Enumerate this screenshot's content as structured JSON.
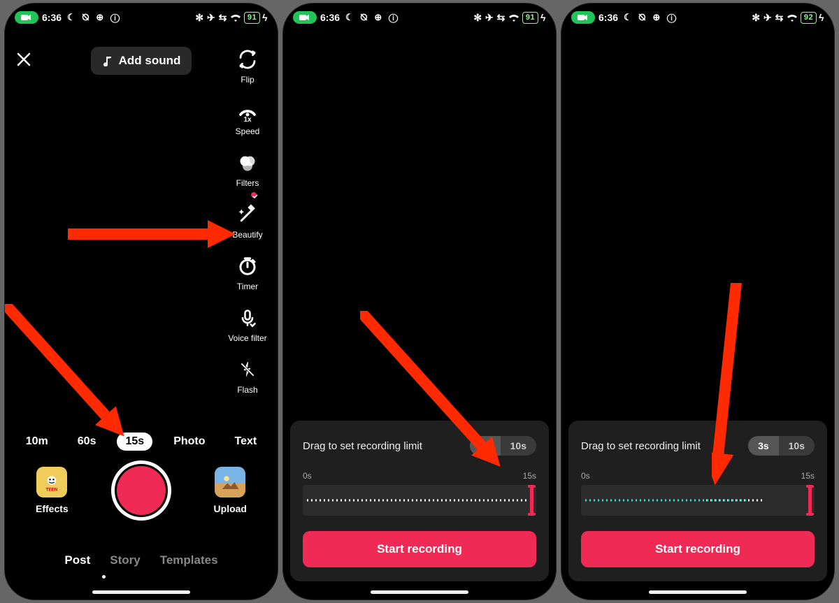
{
  "status": {
    "time": "6:36",
    "left_icons": "☾ ⦰ ⊕ ⓘ",
    "right_icons": "✻ ✈ ⇆",
    "battery1": "91",
    "battery2": "91",
    "battery3": "92"
  },
  "screen1": {
    "add_sound": "Add sound",
    "tools": [
      {
        "id": "flip",
        "label": "Flip"
      },
      {
        "id": "speed",
        "label": "Speed"
      },
      {
        "id": "filters",
        "label": "Filters"
      },
      {
        "id": "beautify",
        "label": "Beautify"
      },
      {
        "id": "timer",
        "label": "Timer"
      },
      {
        "id": "voicefilter",
        "label": "Voice filter"
      },
      {
        "id": "flash",
        "label": "Flash"
      }
    ],
    "durations": [
      "10m",
      "60s",
      "15s",
      "Photo",
      "Text"
    ],
    "duration_active": "15s",
    "effects": "Effects",
    "upload": "Upload",
    "modes": [
      "Post",
      "Story",
      "Templates"
    ],
    "mode_active": "Post"
  },
  "timer_panel": {
    "title": "Drag to set recording limit",
    "seg": [
      "3s",
      "10s"
    ],
    "seg_active": "3s",
    "scale_start": "0s",
    "scale_end": "15s",
    "start": "Start recording"
  }
}
